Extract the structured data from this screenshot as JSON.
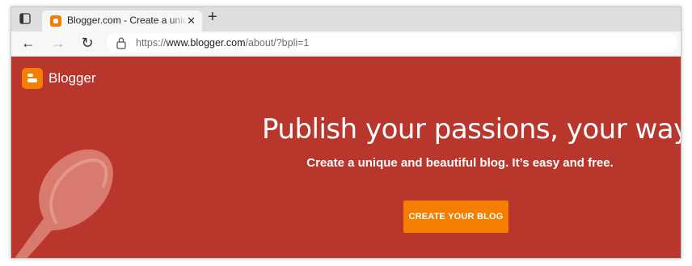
{
  "browser": {
    "tab": {
      "title": "Blogger.com - Create a unique and beautiful blog",
      "close_glyph": "✕",
      "favicon": "blogger-favicon"
    },
    "new_tab_glyph": "+",
    "toolbar": {
      "back_glyph": "←",
      "forward_glyph": "→",
      "reload_glyph": "↻",
      "url_scheme": "https://",
      "url_domain": "www.blogger.com",
      "url_path": "/about/?bpli=1"
    }
  },
  "page": {
    "logo_text": "Blogger",
    "headline": "Publish your passions, your way",
    "subline": "Create a unique and beautiful blog. It’s easy and free.",
    "cta_label": "CREATE YOUR BLOG"
  },
  "colors": {
    "brand_orange": "#f57d00",
    "hero_red": "#b9362d"
  }
}
